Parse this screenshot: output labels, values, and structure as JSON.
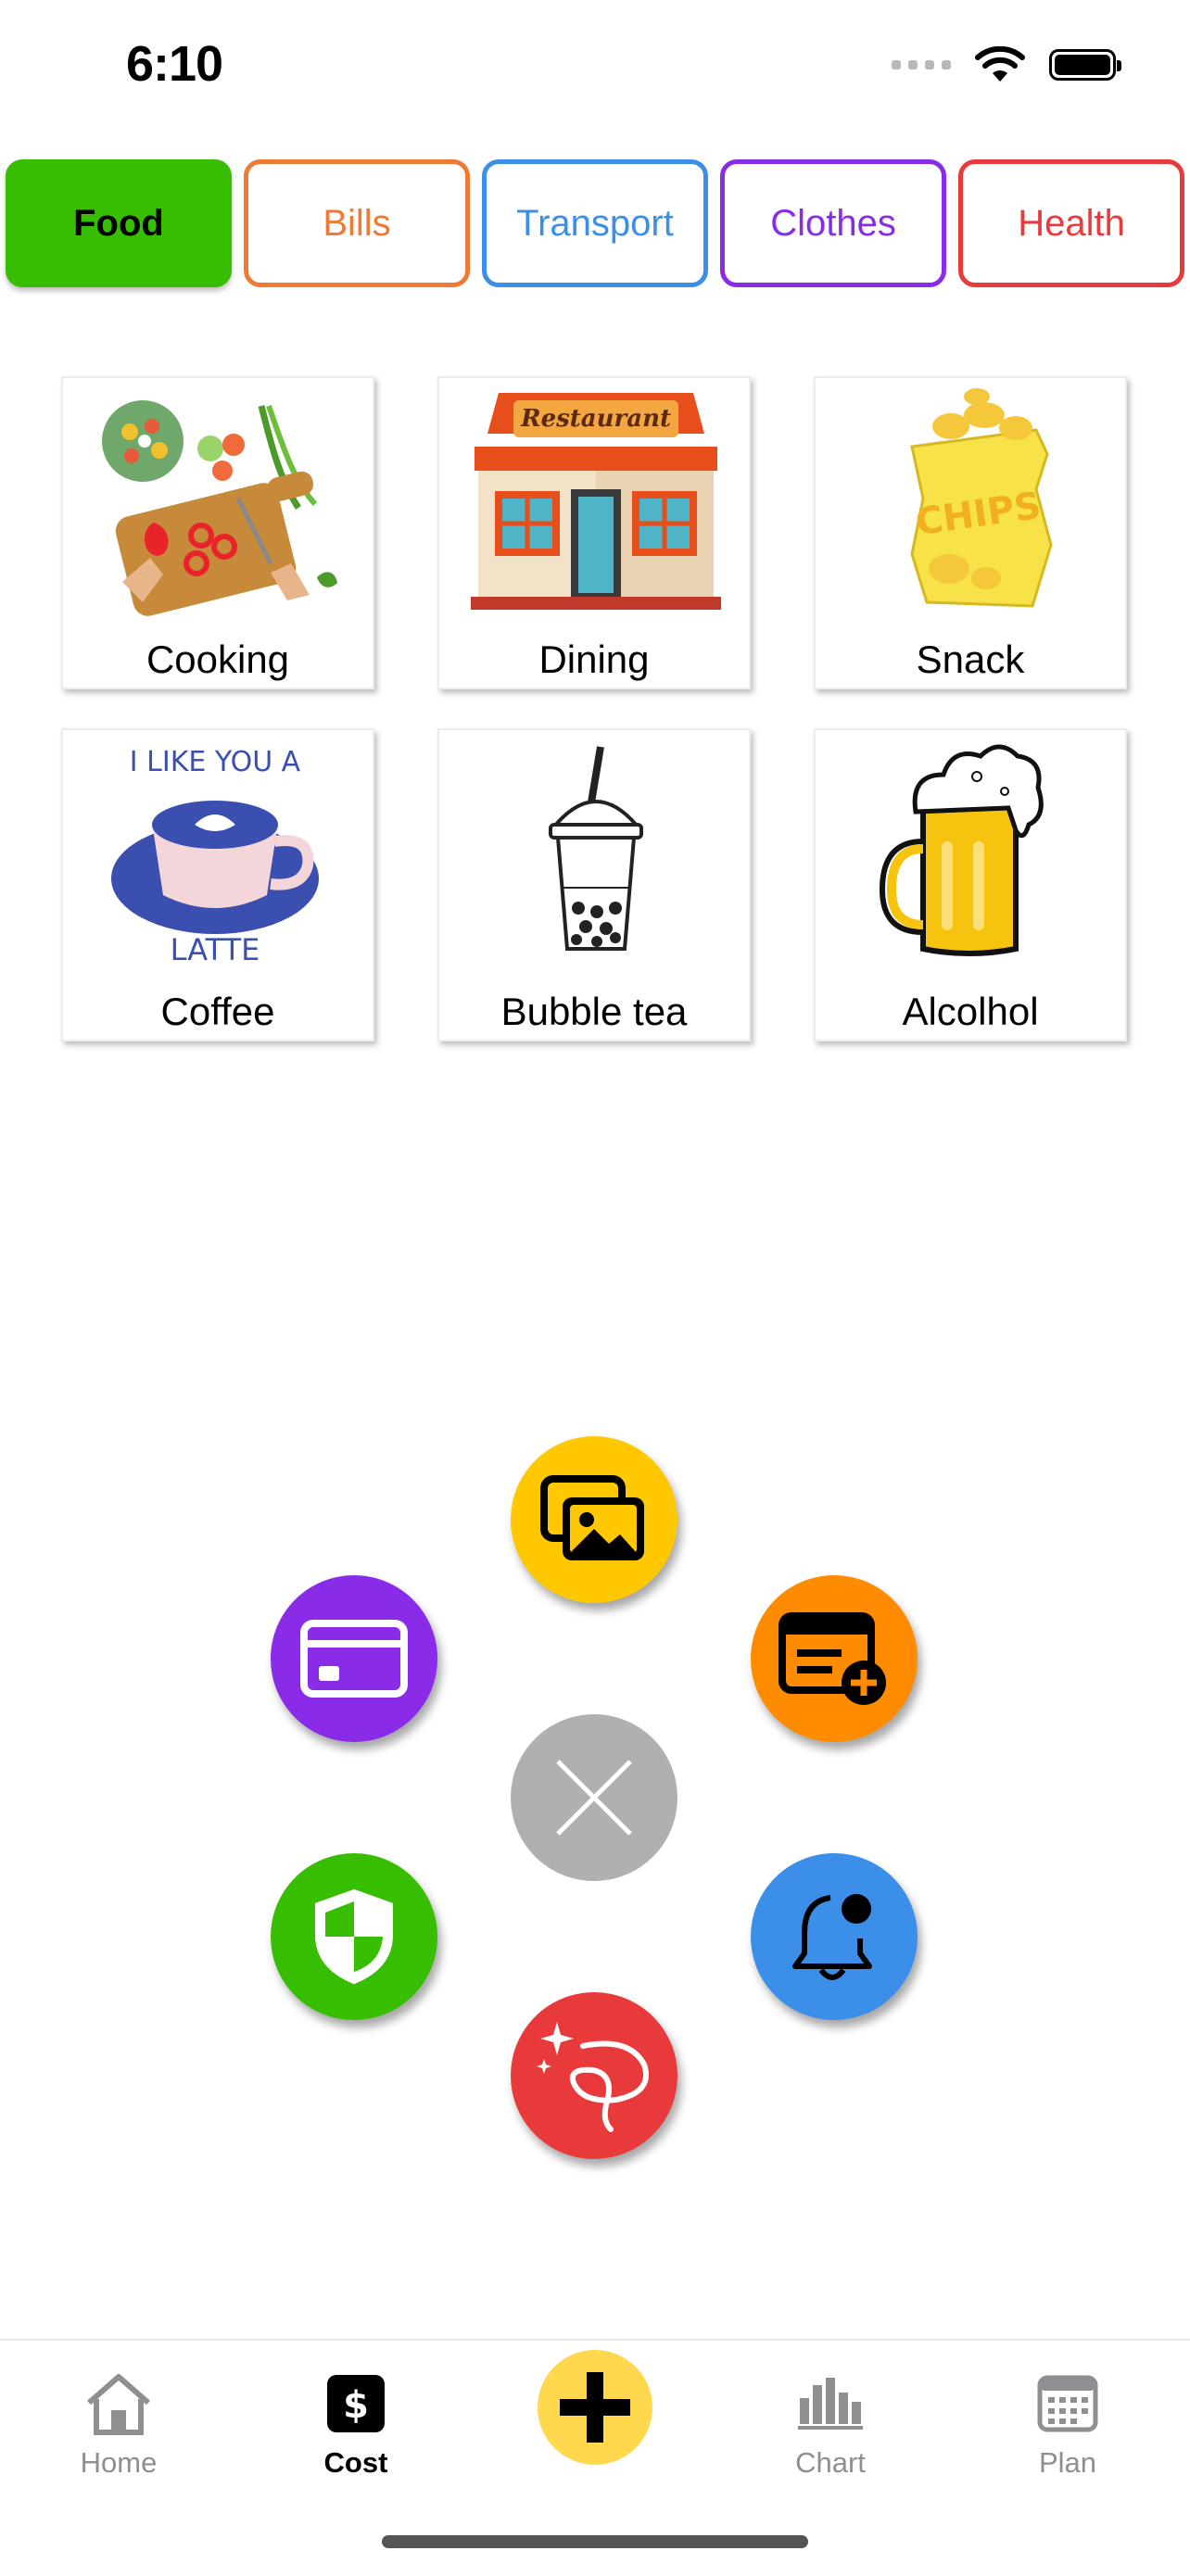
{
  "status_bar": {
    "time": "6:10"
  },
  "tabs": [
    {
      "label": "Food",
      "color": "#38BE00",
      "active": true
    },
    {
      "label": "Bills",
      "color": "#EE7A33"
    },
    {
      "label": "Transport",
      "color": "#3B8FE8"
    },
    {
      "label": "Clothes",
      "color": "#8A2BE8"
    },
    {
      "label": "Health",
      "color": "#E83A3A"
    }
  ],
  "items": [
    {
      "label": "Cooking",
      "icon": "cutting-board-icon"
    },
    {
      "label": "Dining",
      "icon": "restaurant-icon"
    },
    {
      "label": "Snack",
      "icon": "chips-bag-icon"
    },
    {
      "label": "Coffee",
      "icon": "latte-cup-icon"
    },
    {
      "label": "Bubble tea",
      "icon": "bubble-tea-icon"
    },
    {
      "label": "Alcolhol",
      "icon": "beer-mug-icon"
    }
  ],
  "artwork_text": {
    "restaurant_sign": "Restaurant",
    "chips_bag": "CHIPS",
    "latte_top": "I LIKE YOU A",
    "latte_bottom": "LATTE"
  },
  "radial_menu": [
    {
      "name": "gallery",
      "icon": "photo-gallery-icon",
      "color": "#FFC800"
    },
    {
      "name": "add-receipt",
      "icon": "receipt-add-icon",
      "color": "#FF8C00"
    },
    {
      "name": "card",
      "icon": "credit-card-icon",
      "color": "#8A2BE8"
    },
    {
      "name": "close",
      "icon": "close-icon",
      "color": "#B0B0B0"
    },
    {
      "name": "security",
      "icon": "shield-icon",
      "color": "#38BE00"
    },
    {
      "name": "notifications",
      "icon": "bell-icon",
      "color": "#3B8FE8"
    },
    {
      "name": "ai-magic",
      "icon": "sparkles-icon",
      "color": "#E83A3A"
    }
  ],
  "bottom_nav": [
    {
      "label": "Home",
      "icon": "house-icon"
    },
    {
      "label": "Cost",
      "icon": "dollar-icon",
      "active": true
    },
    {
      "label": "",
      "icon": "plus-icon",
      "color": "#FFD84D"
    },
    {
      "label": "Chart",
      "icon": "bar-chart-icon"
    },
    {
      "label": "Plan",
      "icon": "calendar-icon"
    }
  ]
}
